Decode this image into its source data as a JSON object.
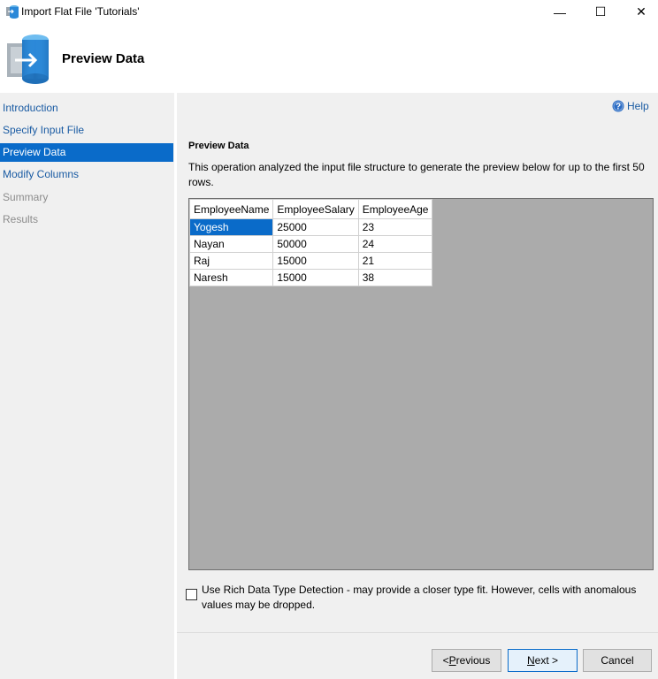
{
  "window": {
    "title": "Import Flat File 'Tutorials'",
    "minimize_glyph": "—",
    "maximize_glyph": "☐",
    "close_glyph": "✕"
  },
  "header": {
    "title": "Preview Data"
  },
  "sidebar": {
    "items": [
      {
        "label": "Introduction",
        "state": "link"
      },
      {
        "label": "Specify Input File",
        "state": "link"
      },
      {
        "label": "Preview Data",
        "state": "active"
      },
      {
        "label": "Modify Columns",
        "state": "link"
      },
      {
        "label": "Summary",
        "state": "disabled"
      },
      {
        "label": "Results",
        "state": "disabled"
      }
    ]
  },
  "main": {
    "help_label": "Help",
    "section_title": "Preview Data",
    "description": "This operation analyzed the input file structure to generate the preview below for up to the first 50 rows.",
    "grid": {
      "columns": [
        "EmployeeName",
        "EmployeeSalary",
        "EmployeeAge"
      ],
      "rows": [
        [
          "Yogesh",
          "25000",
          "23"
        ],
        [
          "Nayan",
          "50000",
          "24"
        ],
        [
          "Raj",
          "15000",
          "21"
        ],
        [
          "Naresh",
          "15000",
          "38"
        ]
      ],
      "selected_cell": "Yogesh"
    },
    "rich_detection": {
      "checked": false,
      "label": "Use Rich Data Type Detection - may provide a closer type fit. However, cells with anomalous values may be dropped."
    }
  },
  "footer": {
    "previous_prefix": "< ",
    "previous_mnemonic": "P",
    "previous_rest": "revious",
    "next_mnemonic": "N",
    "next_rest": "ext >",
    "cancel_label": "Cancel"
  },
  "colors": {
    "accent": "#0a6bc9",
    "link": "#1a5ba3",
    "panel": "#f0f0f0",
    "grid_background": "#ababab"
  },
  "icons": {
    "app": "sql-server-icon",
    "header": "database-import-icon",
    "help": "help-icon"
  }
}
